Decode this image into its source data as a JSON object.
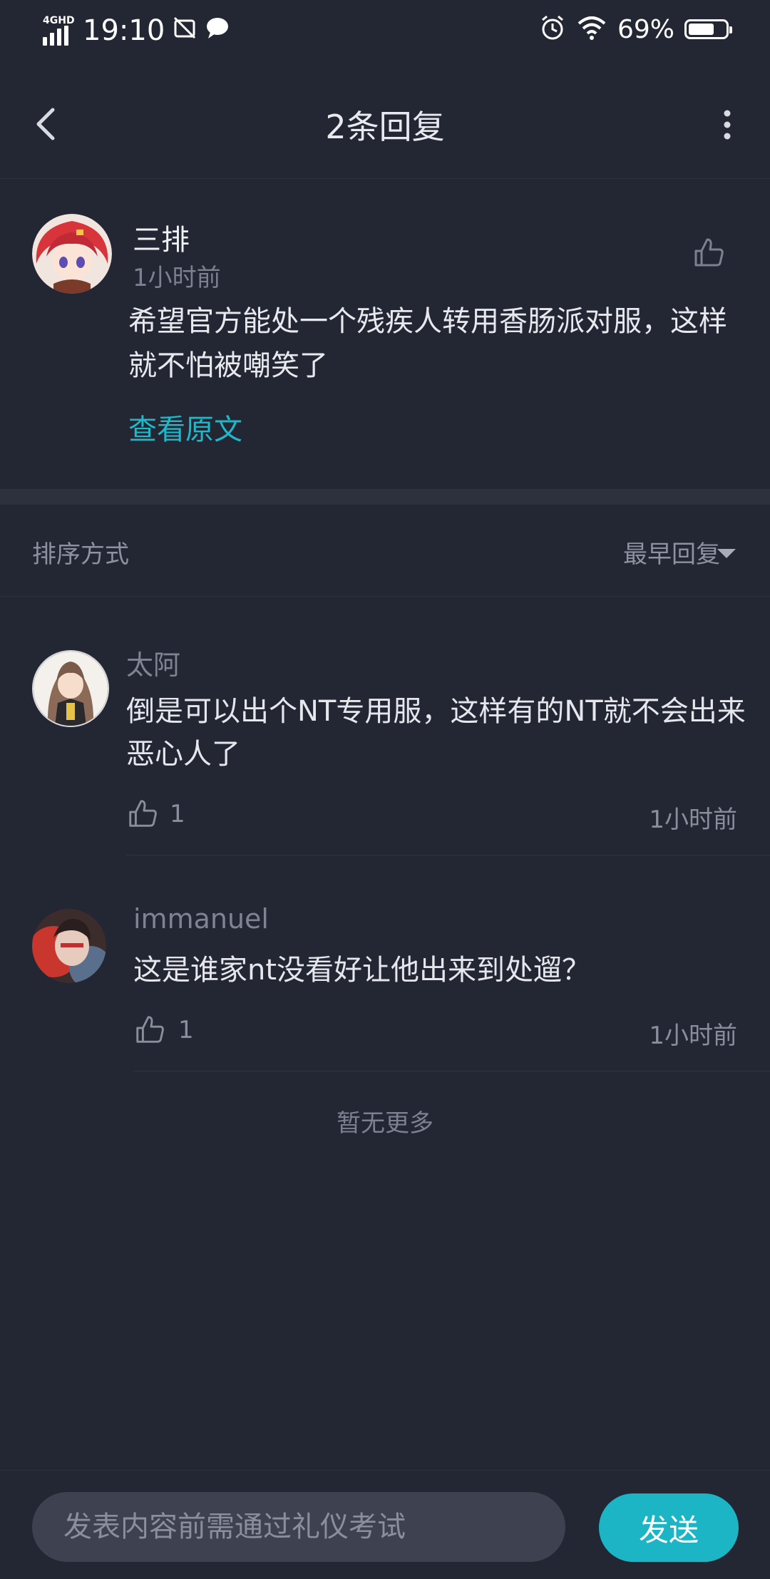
{
  "status_bar": {
    "network": "4GHD",
    "time": "19:10",
    "battery_percent": "69%",
    "battery_level": 0.69,
    "icons": [
      "signal-icon",
      "camera-off-icon",
      "chat-bubble-icon",
      "alarm-icon",
      "wifi-icon",
      "battery-icon"
    ]
  },
  "header": {
    "title": "2条回复",
    "back_icon": "chevron-left-icon",
    "more_icon": "more-vertical-icon"
  },
  "original_comment": {
    "author": "三排",
    "time": "1小时前",
    "text": "希望官方能处一个残疾人转用香肠派对服，这样就不怕被嘲笑了",
    "view_original": "查看原文",
    "like_icon": "thumbs-up-icon"
  },
  "sort": {
    "label": "排序方式",
    "value": "最早回复",
    "icon": "caret-down-icon"
  },
  "replies": [
    {
      "author": "太阿",
      "text": "倒是可以出个NT专用服，这样有的NT就不会出来恶心人了",
      "likes": "1",
      "time": "1小时前"
    },
    {
      "author": "immanuel",
      "text": "这是谁家nt没看好让他出来到处遛？",
      "likes": "1",
      "time": "1小时前"
    }
  ],
  "footer_note": "暂无更多",
  "composer": {
    "placeholder": "发表内容前需通过礼仪考试",
    "send_label": "发送"
  },
  "colors": {
    "background": "#232633",
    "accent": "#1cb5c5",
    "link": "#1fb8c8",
    "input_bg": "#3d4150"
  }
}
